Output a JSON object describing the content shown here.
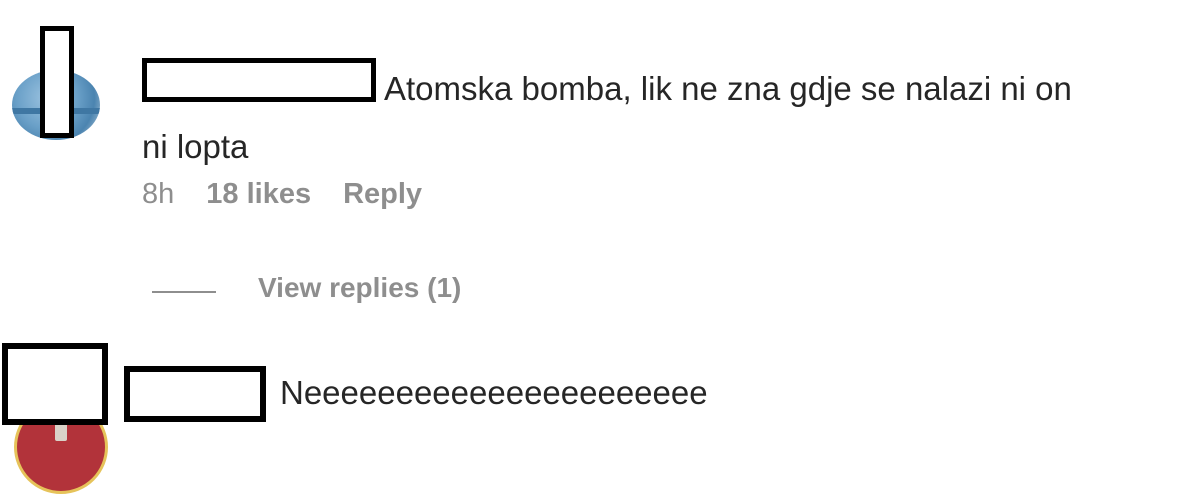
{
  "comments": [
    {
      "text_line1": "Atomska bomba, lik ne zna gdje se nalazi ni on",
      "text_line2": "ni lopta",
      "time": "8h",
      "likes": "18 likes",
      "reply_label": "Reply",
      "view_replies": "View replies (1)"
    },
    {
      "text": "Neeeeeeeeeeeeeeeeeeeeee"
    }
  ]
}
